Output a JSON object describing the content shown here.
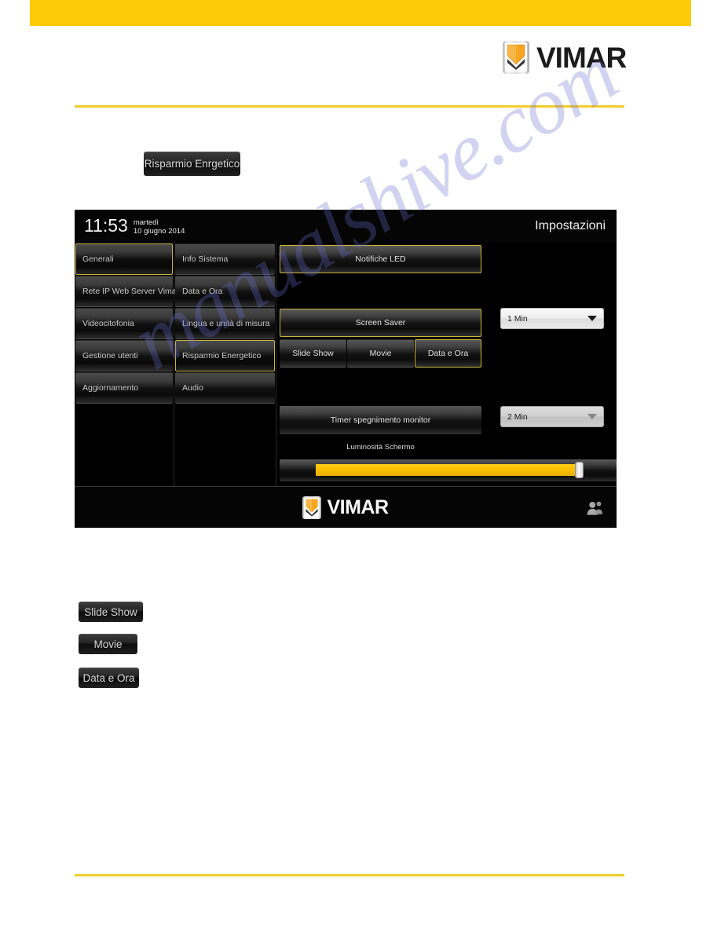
{
  "page": {
    "banner_color": "#FCCC08",
    "rule_color": "#F2CC2B",
    "watermark": "manualshive.com"
  },
  "brand": {
    "name": "VIMAR",
    "mark_icon": "vimar-chevron-logo"
  },
  "callouts": [
    {
      "id": "risparmio",
      "label": "Risparmio Enrgetico"
    },
    {
      "id": "slideshow",
      "label": "Slide Show"
    },
    {
      "id": "movie",
      "label": "Movie"
    },
    {
      "id": "dataeora",
      "label": "Data e Ora"
    }
  ],
  "device": {
    "topbar": {
      "time": "11:53",
      "weekday": "martedì",
      "date": "10 giugno 2014",
      "title": "Impostazioni"
    },
    "menu_primary": [
      {
        "label": "Generali",
        "selected": true
      },
      {
        "label": "Rete IP Web Server Vimar",
        "selected": false
      },
      {
        "label": "Videocitofonia",
        "selected": false
      },
      {
        "label": "Gestione utenti",
        "selected": false
      },
      {
        "label": "Aggiornamento",
        "selected": false
      }
    ],
    "menu_secondary": [
      {
        "label": "Info Sistema",
        "selected": false
      },
      {
        "label": "Data e Ora",
        "selected": false
      },
      {
        "label": "Lingua e unità di misura",
        "selected": false
      },
      {
        "label": "Risparmio Energetico",
        "selected": true
      },
      {
        "label": "Audio",
        "selected": false
      }
    ],
    "content": {
      "led_button": "Notifiche LED",
      "screensaver_button": "Screen Saver",
      "screensaver_tabs": [
        {
          "label": "Slide Show",
          "selected": false
        },
        {
          "label": "Movie",
          "selected": false
        },
        {
          "label": "Data e Ora",
          "selected": true
        }
      ],
      "screensaver_delay": "1 Min",
      "monitor_timer_button": "Timer spegnimento monitor",
      "monitor_timer_delay": "2 Min",
      "brightness_label": "Luminosità Schermo",
      "brightness_value": 94
    },
    "bottombar": {
      "brand": "VIMAR",
      "users_icon": "users-icon"
    }
  }
}
